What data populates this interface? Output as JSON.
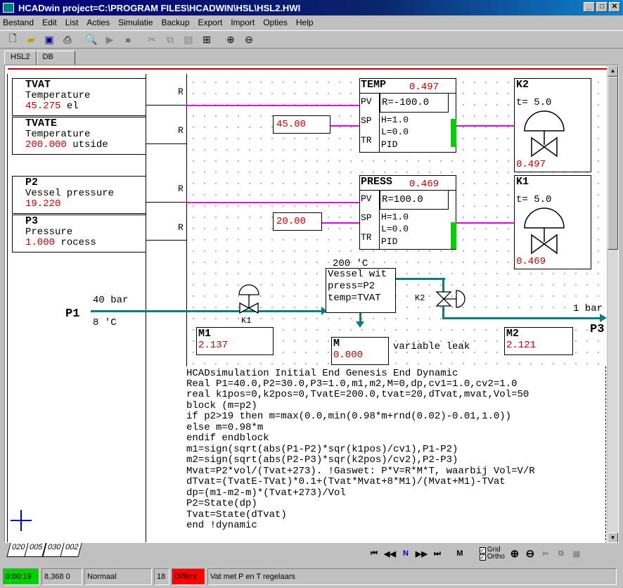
{
  "window": {
    "title": "HCADwin project=C:\\PROGRAM FILES\\HCADWIN\\HSL\\HSL2.HWI",
    "controls": [
      "_",
      "□",
      "✕"
    ]
  },
  "menu": [
    "Bestand",
    "Edit",
    "List",
    "Acties",
    "Simulatie",
    "Backup",
    "Export",
    "Import",
    "Opties",
    "Help"
  ],
  "tabs": {
    "top": [
      "HSL2",
      "DB"
    ],
    "active": "HSL2"
  },
  "signals": [
    {
      "name": "TVAT",
      "desc": "Temperature",
      "value": "45.275",
      "suffix": " el",
      "flag": "R"
    },
    {
      "name": "TVATE",
      "desc": "Temperature",
      "value": "200.000",
      "suffix": " utside",
      "flag": "R"
    },
    {
      "name": "P2",
      "desc": "Vessel pressure",
      "value": "19.220",
      "suffix": "",
      "flag": "R"
    },
    {
      "name": "P3",
      "desc": "Pressure",
      "value": "1.000",
      "suffix": " rocess",
      "flag": "R"
    }
  ],
  "controllers": [
    {
      "name": "TEMP",
      "value": "0.497",
      "pv_label": "PV",
      "sp_label": "SP",
      "tr_label": "TR",
      "range": "R=-100.0",
      "h": "H=1.0",
      "l": "L=0.0",
      "mode": "PID",
      "setpoint": "45.00"
    },
    {
      "name": "PRESS",
      "value": "0.469",
      "pv_label": "PV",
      "sp_label": "SP",
      "tr_label": "TR",
      "range": "R=100.0",
      "h": "H=1.0",
      "l": "L=0.0",
      "mode": "PID",
      "setpoint": "20.00"
    }
  ],
  "valves": [
    {
      "name": "K2",
      "time": "t= 5.0",
      "value": "0.497"
    },
    {
      "name": "K1",
      "time": "t= 5.0",
      "value": "0.469"
    }
  ],
  "process": {
    "p1_label": "P1",
    "p1_pressure": "40 bar",
    "p1_temp": "8 'C",
    "k1_label": "K1",
    "k2_label": "K2",
    "vessel_temp": "200 'C",
    "vessel_lines": [
      "Vessel wit",
      "press=P2",
      "temp=TVAT"
    ],
    "p3_label": "P3",
    "p3_pressure": "1 bar",
    "leak_label": "variable leak",
    "m1": {
      "name": "M1",
      "value": "2.137"
    },
    "m": {
      "name": "M",
      "value": "0.000"
    },
    "m2": {
      "name": "M2",
      "value": "2.121"
    }
  },
  "code": [
    "HCADsimulation Initial End Genesis End Dynamic",
    "Real P1=40.0,P2=30.0,P3=1.0,m1,m2,M=0,dp,cv1=1.0,cv2=1.0",
    "real k1pos=0,k2pos=0,TvatE=200.0,tvat=20,dTvat,mvat,Vol=50",
    "block (m=p2)",
    "if p2>19 then m=max(0.0,min(0.98*m+rnd(0.02)-0.01,1.0))",
    "else m=0.98*m",
    "endif endblock",
    "m1=sign(sqrt(abs(P1-P2)*sqr(k1pos)/cv1),P1-P2)",
    "m2=sign(sqrt(abs(P2-P3)*sqr(k2pos)/cv2),P2-P3)",
    "Mvat=P2*vol/(Tvat+273). !Gaswet: P*V=R*M*T, waarbij Vol=V/R",
    "dTvat=(TvatE-TVat)*0.1+(Tvat*Mvat+8*M1)/(Mvat+M1)-TVat",
    "dp=(m1-m2-m)*(Tvat+273)/Vol",
    "P2=State(dp)",
    "Tvat=State(dTvat)",
    "end !dynamic"
  ],
  "bottom_tabs": [
    "020",
    "005",
    "030",
    "002"
  ],
  "nav": {
    "buttons": [
      "⏮",
      "◀◀",
      "N",
      "▶▶",
      "⏭",
      "M"
    ],
    "grid_label": "Grid",
    "ortho_label": "Ortho"
  },
  "status": {
    "time": "0:00:19",
    "value": "8,368 0",
    "mode": "Normaal",
    "count": "18",
    "differs": "Differs",
    "description": "Vat met P en T regelaars"
  },
  "colors": {
    "signal": "#e000e0",
    "pipe": "#008080",
    "value": "#c00000",
    "indicator": "#00d000",
    "status_ok": "#00d000",
    "status_warn": "#ff0000"
  }
}
